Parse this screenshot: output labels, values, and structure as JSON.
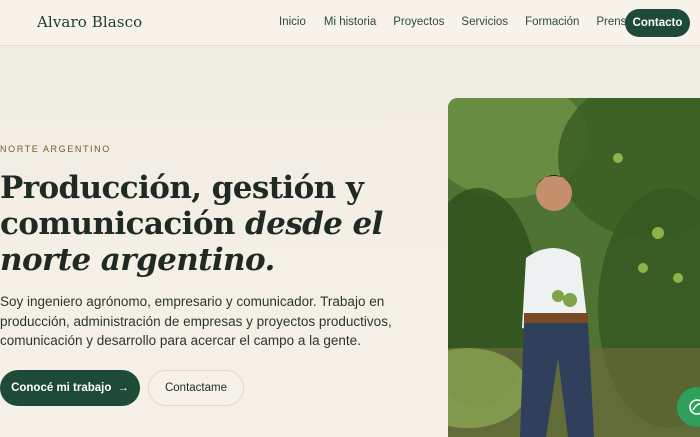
{
  "header": {
    "brand": "Alvaro Blasco",
    "nav": [
      "Inicio",
      "Mi historia",
      "Proyectos",
      "Servicios",
      "Formación",
      "Prensa"
    ],
    "cta": "Contacto"
  },
  "hero": {
    "eyebrow": "NORTE ARGENTINO",
    "headline_part1": "Producción, gestión y comunicación ",
    "headline_italic": "desde el norte argentino.",
    "lead": "Soy ingeniero agrónomo, empresario y comunicador. Trabajo en producción, administración de empresas y proyectos productivos, comunicación y desarrollo para acercar el campo a la gente.",
    "primary_button": "Conocé mi trabajo",
    "primary_arrow": "→",
    "secondary_button": "Contactame"
  },
  "colors": {
    "accent": "#1e4a38",
    "eyebrow": "#7a5a32",
    "background": "#f5f0e6",
    "fab": "#2ea05a"
  },
  "icons": {
    "fab": "leaf-chat-icon",
    "arrow": "arrow-right-icon"
  }
}
